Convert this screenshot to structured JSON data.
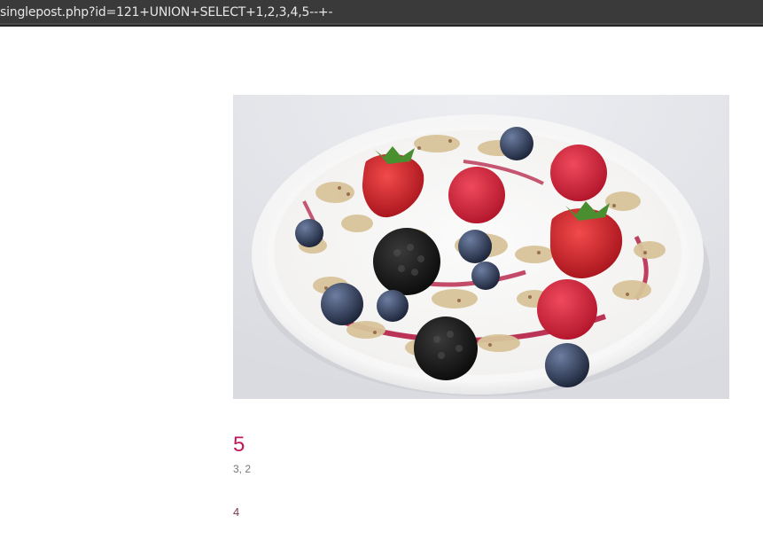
{
  "browser": {
    "url": "singlepost.php?id=121+UNION+SELECT+1,2,3,4,5--+-"
  },
  "post": {
    "title": "5",
    "meta": "3, 2",
    "body": "4",
    "image_subject": "yogurt-bowl-with-berries-and-granola"
  },
  "colors": {
    "title": "#c2185b",
    "meta": "#777777",
    "body": "#7a3a55",
    "urlbar": "#3a3a3a"
  }
}
